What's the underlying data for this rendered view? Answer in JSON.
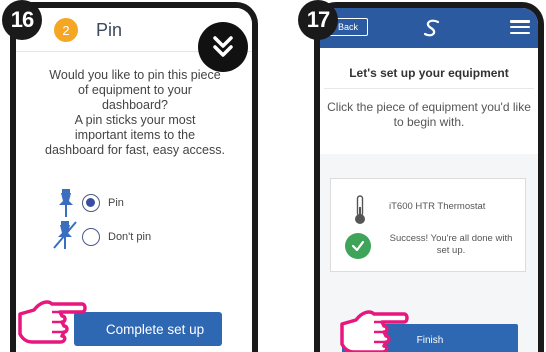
{
  "step_a": {
    "badge": "16",
    "header": {
      "step_number": "2",
      "title": "Pin"
    },
    "question_lines": [
      "Would you like to pin this piece",
      "of equipment to your",
      "dashboard?",
      "A pin sticks your most",
      "important items to the",
      "dashboard for fast, easy access."
    ],
    "options": [
      {
        "label": "Pin",
        "selected": true
      },
      {
        "label": "Don't pin",
        "selected": false
      }
    ],
    "complete_button": "Complete set up",
    "scroll_icon": "double-chevron-down-icon"
  },
  "step_b": {
    "badge": "17",
    "header": {
      "back_label": "Back",
      "logo_icon": "s-logo-icon",
      "menu_icon": "hamburger-menu-icon"
    },
    "title": "Let's set up your equipment",
    "instruction_lines": [
      "Click the piece of equipment you'd like",
      "to begin with."
    ],
    "device": {
      "name": "iT600 HTR Thermostat",
      "icon": "thermometer-icon"
    },
    "success_lines": [
      "Success! You're all done with",
      "set up."
    ],
    "finish_button": "Finish"
  },
  "colors": {
    "primary_blue": "#2e67b2",
    "header_blue": "#2c5aa0",
    "step_orange": "#f5a623",
    "success_green": "#3ea45a",
    "hand_pink": "#e8177e"
  }
}
